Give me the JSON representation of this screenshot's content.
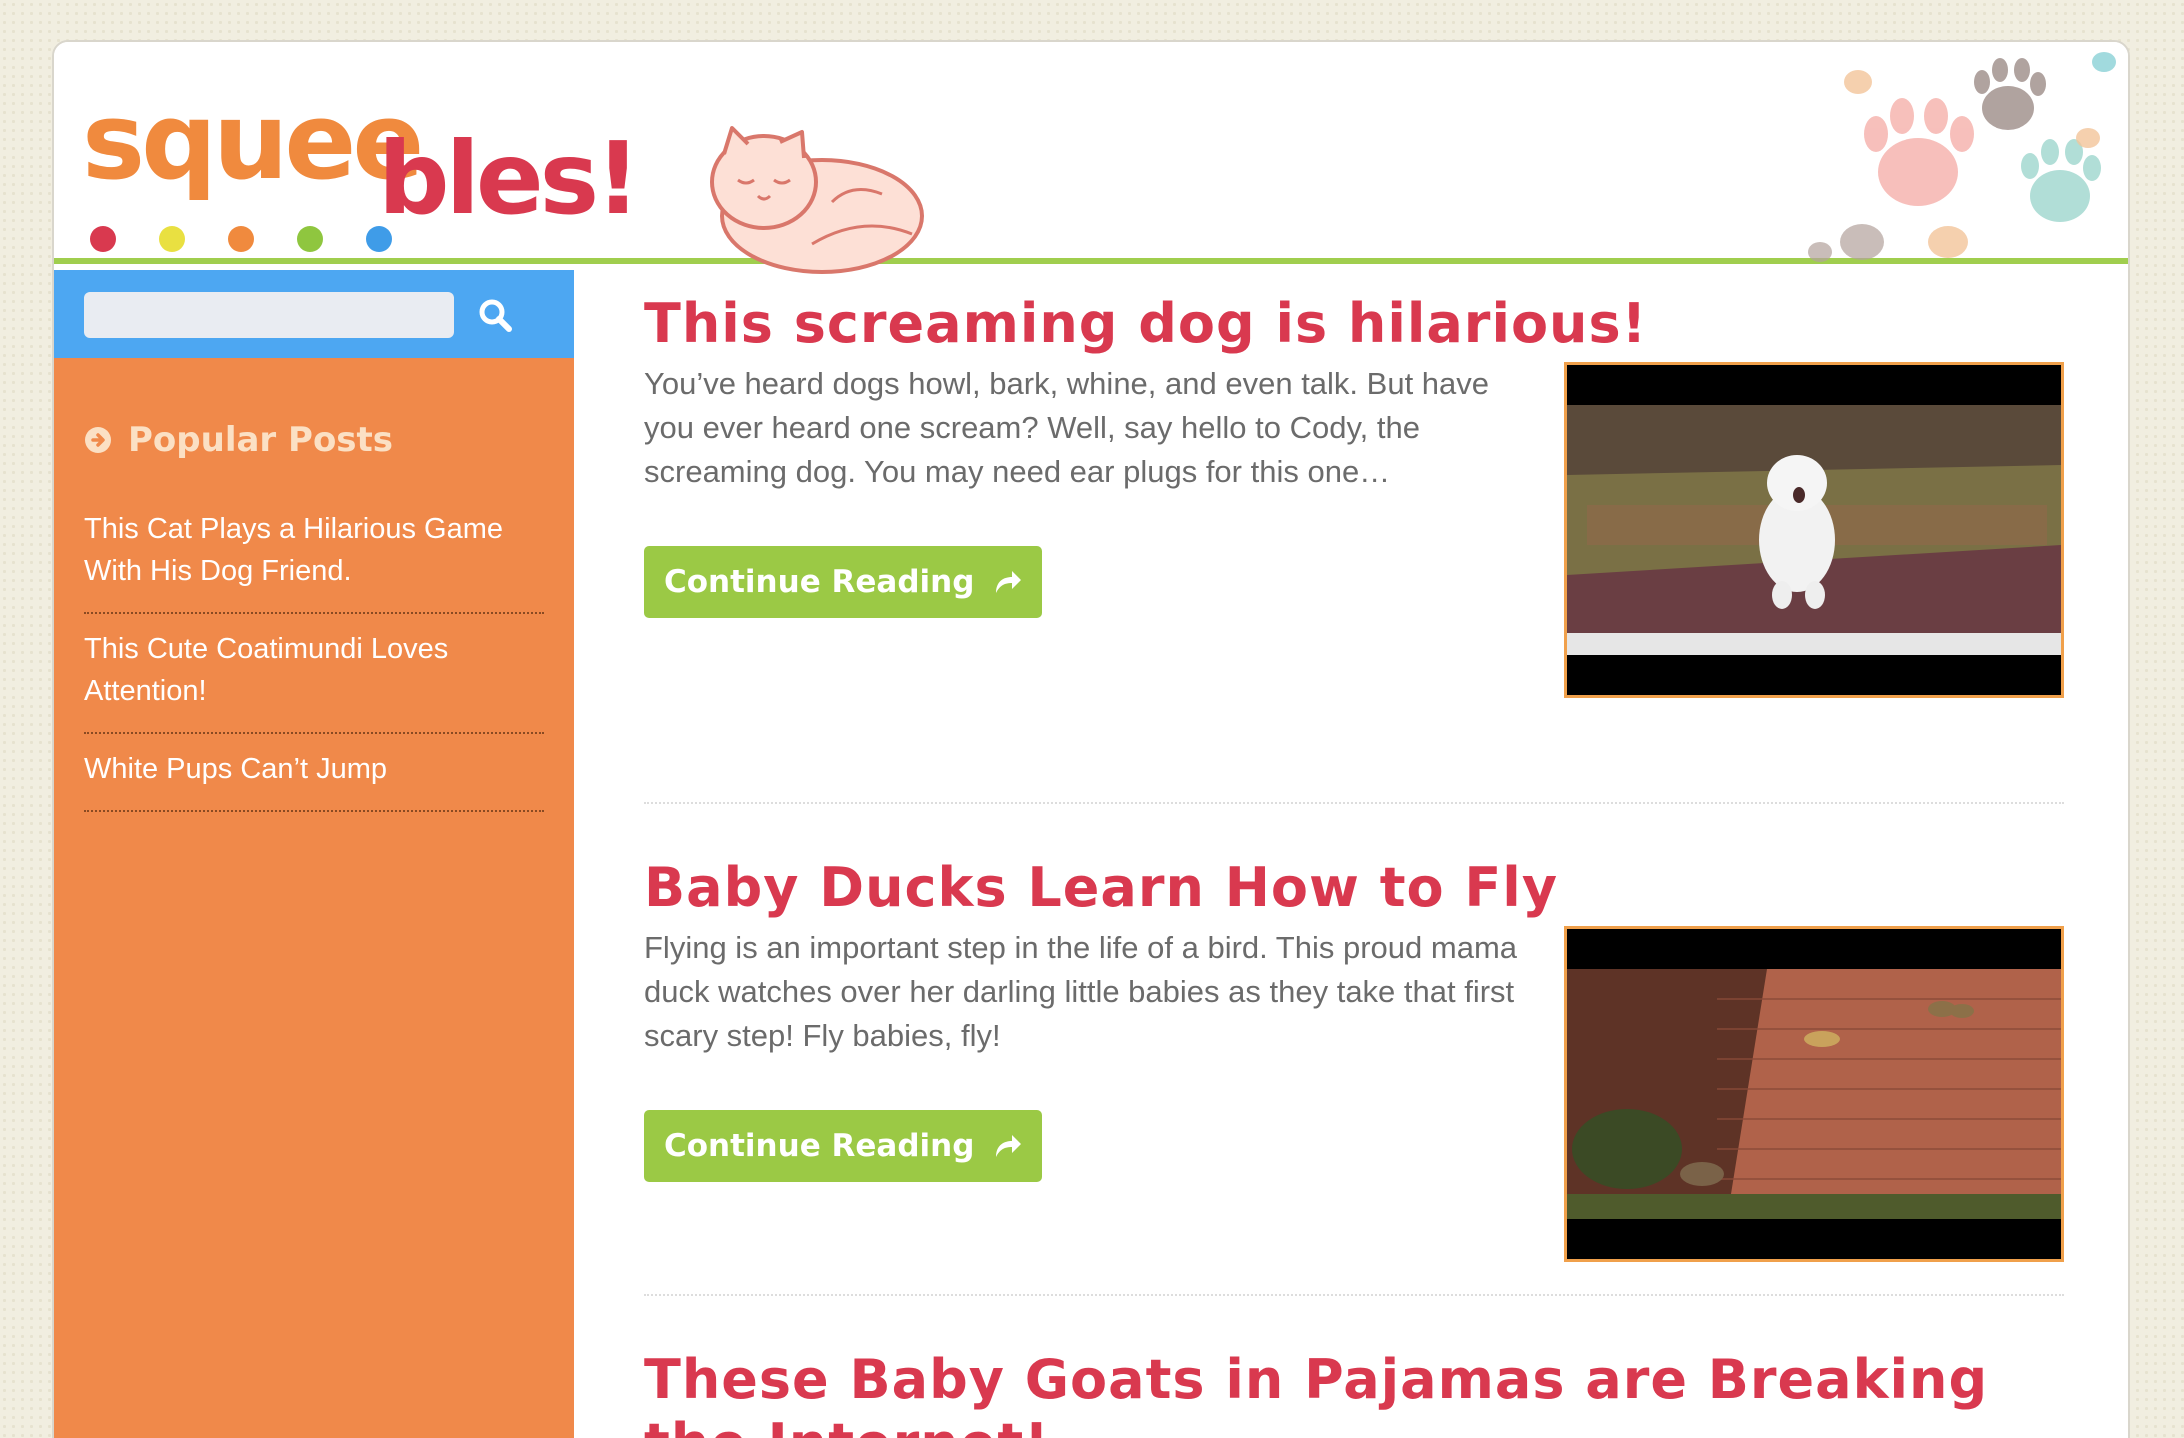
{
  "brand": {
    "logo_part1": "squee",
    "logo_part2": "bles!",
    "dot_colors": [
      "#d9394f",
      "#e9e041",
      "#f08a3e",
      "#8fc63f",
      "#3f9ce8"
    ],
    "primary_color": "#d9394f",
    "accent_green": "#9bc945",
    "sidebar_color": "#f0894a",
    "search_bar_color": "#4da7f2"
  },
  "search": {
    "placeholder": "",
    "icon": "search-icon"
  },
  "sidebar": {
    "widget_title": "Popular Posts",
    "widget_icon": "arrow-circle-right-icon",
    "popular_posts": [
      {
        "label": "This Cat Plays a Hilarious Game With His Dog Friend."
      },
      {
        "label": "This Cute Coatimundi Loves Attention!"
      },
      {
        "label": "White Pups Can’t Jump"
      }
    ]
  },
  "posts": [
    {
      "title": "This screaming dog is hilarious!",
      "excerpt": "You’ve heard dogs howl, bark, whine, and even talk. But have you ever heard one scream? Well, say hello to Cody, the screaming dog. You may need ear plugs for this one…",
      "button_label": "Continue Reading",
      "button_icon": "share-arrow-icon"
    },
    {
      "title": "Baby Ducks Learn How to Fly",
      "excerpt": "Flying is an important step in the life of a bird. This proud mama duck watches over her darling little babies as they take that first scary step! Fly babies, fly!",
      "button_label": "Continue Reading",
      "button_icon": "share-arrow-icon"
    },
    {
      "title": "These Baby Goats in Pajamas are Breaking the Internet!"
    }
  ]
}
